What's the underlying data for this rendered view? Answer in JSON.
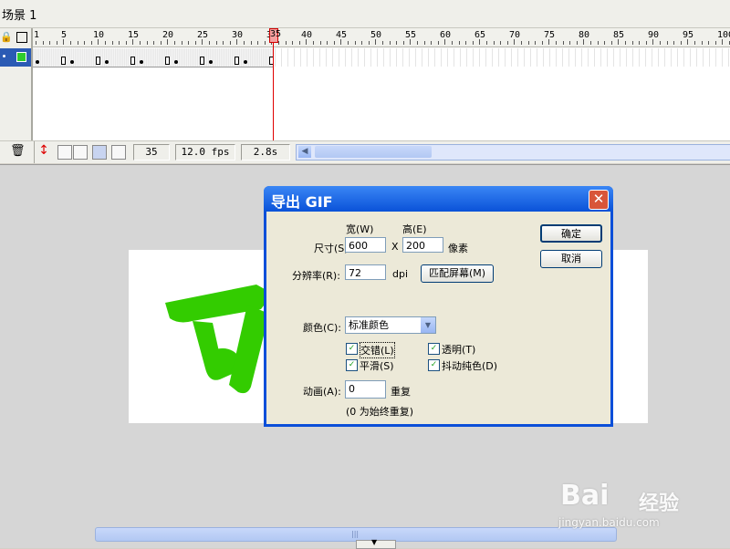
{
  "scene": {
    "title": "场景 1"
  },
  "timeline": {
    "ruler_numbers": [
      "1",
      "5",
      "10",
      "15",
      "20",
      "25",
      "30",
      "35",
      "40",
      "45",
      "50",
      "55",
      "60",
      "65",
      "70",
      "75",
      "80",
      "85",
      "90",
      "95",
      "100"
    ],
    "current_frame": "35",
    "frame_rate": "12.0 fps",
    "elapsed_time": "2.8s"
  },
  "dialog": {
    "title": "导出 GIF",
    "close_icon": "close-icon",
    "size_label": "尺寸(S):",
    "width_label": "宽(W)",
    "height_label": "高(E)",
    "width_value": "600",
    "x_separator": "X",
    "height_value": "200",
    "pixels_unit": "像素",
    "resolution_label": "分辨率(R):",
    "resolution_value": "72",
    "dpi_unit": "dpi",
    "match_screen_button": "匹配屏幕(M)",
    "ok_button": "确定",
    "cancel_button": "取消",
    "colors_label": "颜色(C):",
    "colors_value": "标准颜色",
    "checkboxes": {
      "interlace": {
        "label": "交错(L)",
        "checked": true
      },
      "transparent": {
        "label": "透明(T)",
        "checked": true
      },
      "smooth": {
        "label": "平滑(S)",
        "checked": true
      },
      "dither": {
        "label": "抖动纯色(D)",
        "checked": true
      }
    },
    "animation_label": "动画(A):",
    "animation_value": "0",
    "repeat_unit": "重复",
    "animation_hint": "(0 为始终重复)"
  },
  "watermark": {
    "brand": "Bai",
    "product": "经验",
    "url": "jingyan.baidu.com"
  },
  "colors": {
    "title_bar": "#0a52d8",
    "close_button": "#d8553a",
    "artwork_green": "#33cc00",
    "playhead": "#e00000"
  }
}
